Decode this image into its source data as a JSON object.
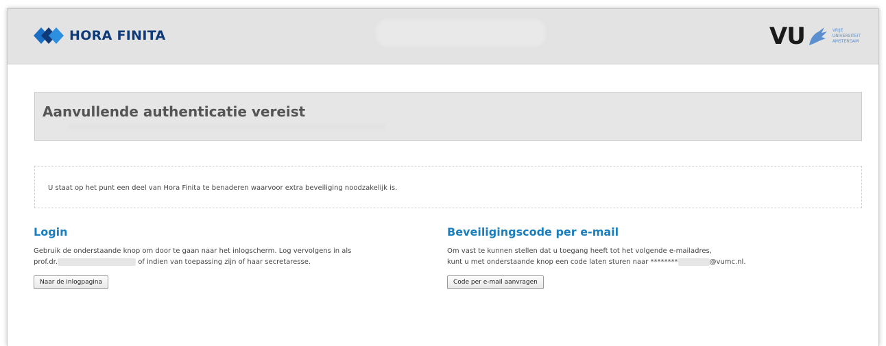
{
  "header": {
    "brand": "HORA FINITA",
    "institution_short": "VU",
    "institution_full": [
      "VRIJE",
      "UNIVERSITEIT",
      "AMSTERDAM"
    ]
  },
  "page": {
    "title": "Aanvullende authenticatie vereist",
    "notice": "U staat op het punt een deel van Hora Finita te benaderen waarvoor extra beveiliging noodzakelijk is."
  },
  "login": {
    "heading": "Login",
    "line1": "Gebruik de onderstaande knop om door te gaan naar het inlogscherm. Log vervolgens in als",
    "line2_prefix": "prof.dr.",
    "line2_suffix": " of indien van toepassing zijn of haar secretaresse.",
    "button": "Naar de inlogpagina"
  },
  "email_code": {
    "heading": "Beveiligingscode per e-mail",
    "line1": "Om vast te kunnen stellen dat u toegang heeft tot het volgende e-mailadres,",
    "line2_prefix": "kunt u met onderstaande knop een code laten sturen naar ********",
    "line2_suffix": "@vumc.nl.",
    "button": "Code per e-mail aanvragen"
  },
  "colors": {
    "brand_navy": "#0f3a7a",
    "heading_blue": "#1b7fbd",
    "vu_blue": "#5b8fcf"
  }
}
